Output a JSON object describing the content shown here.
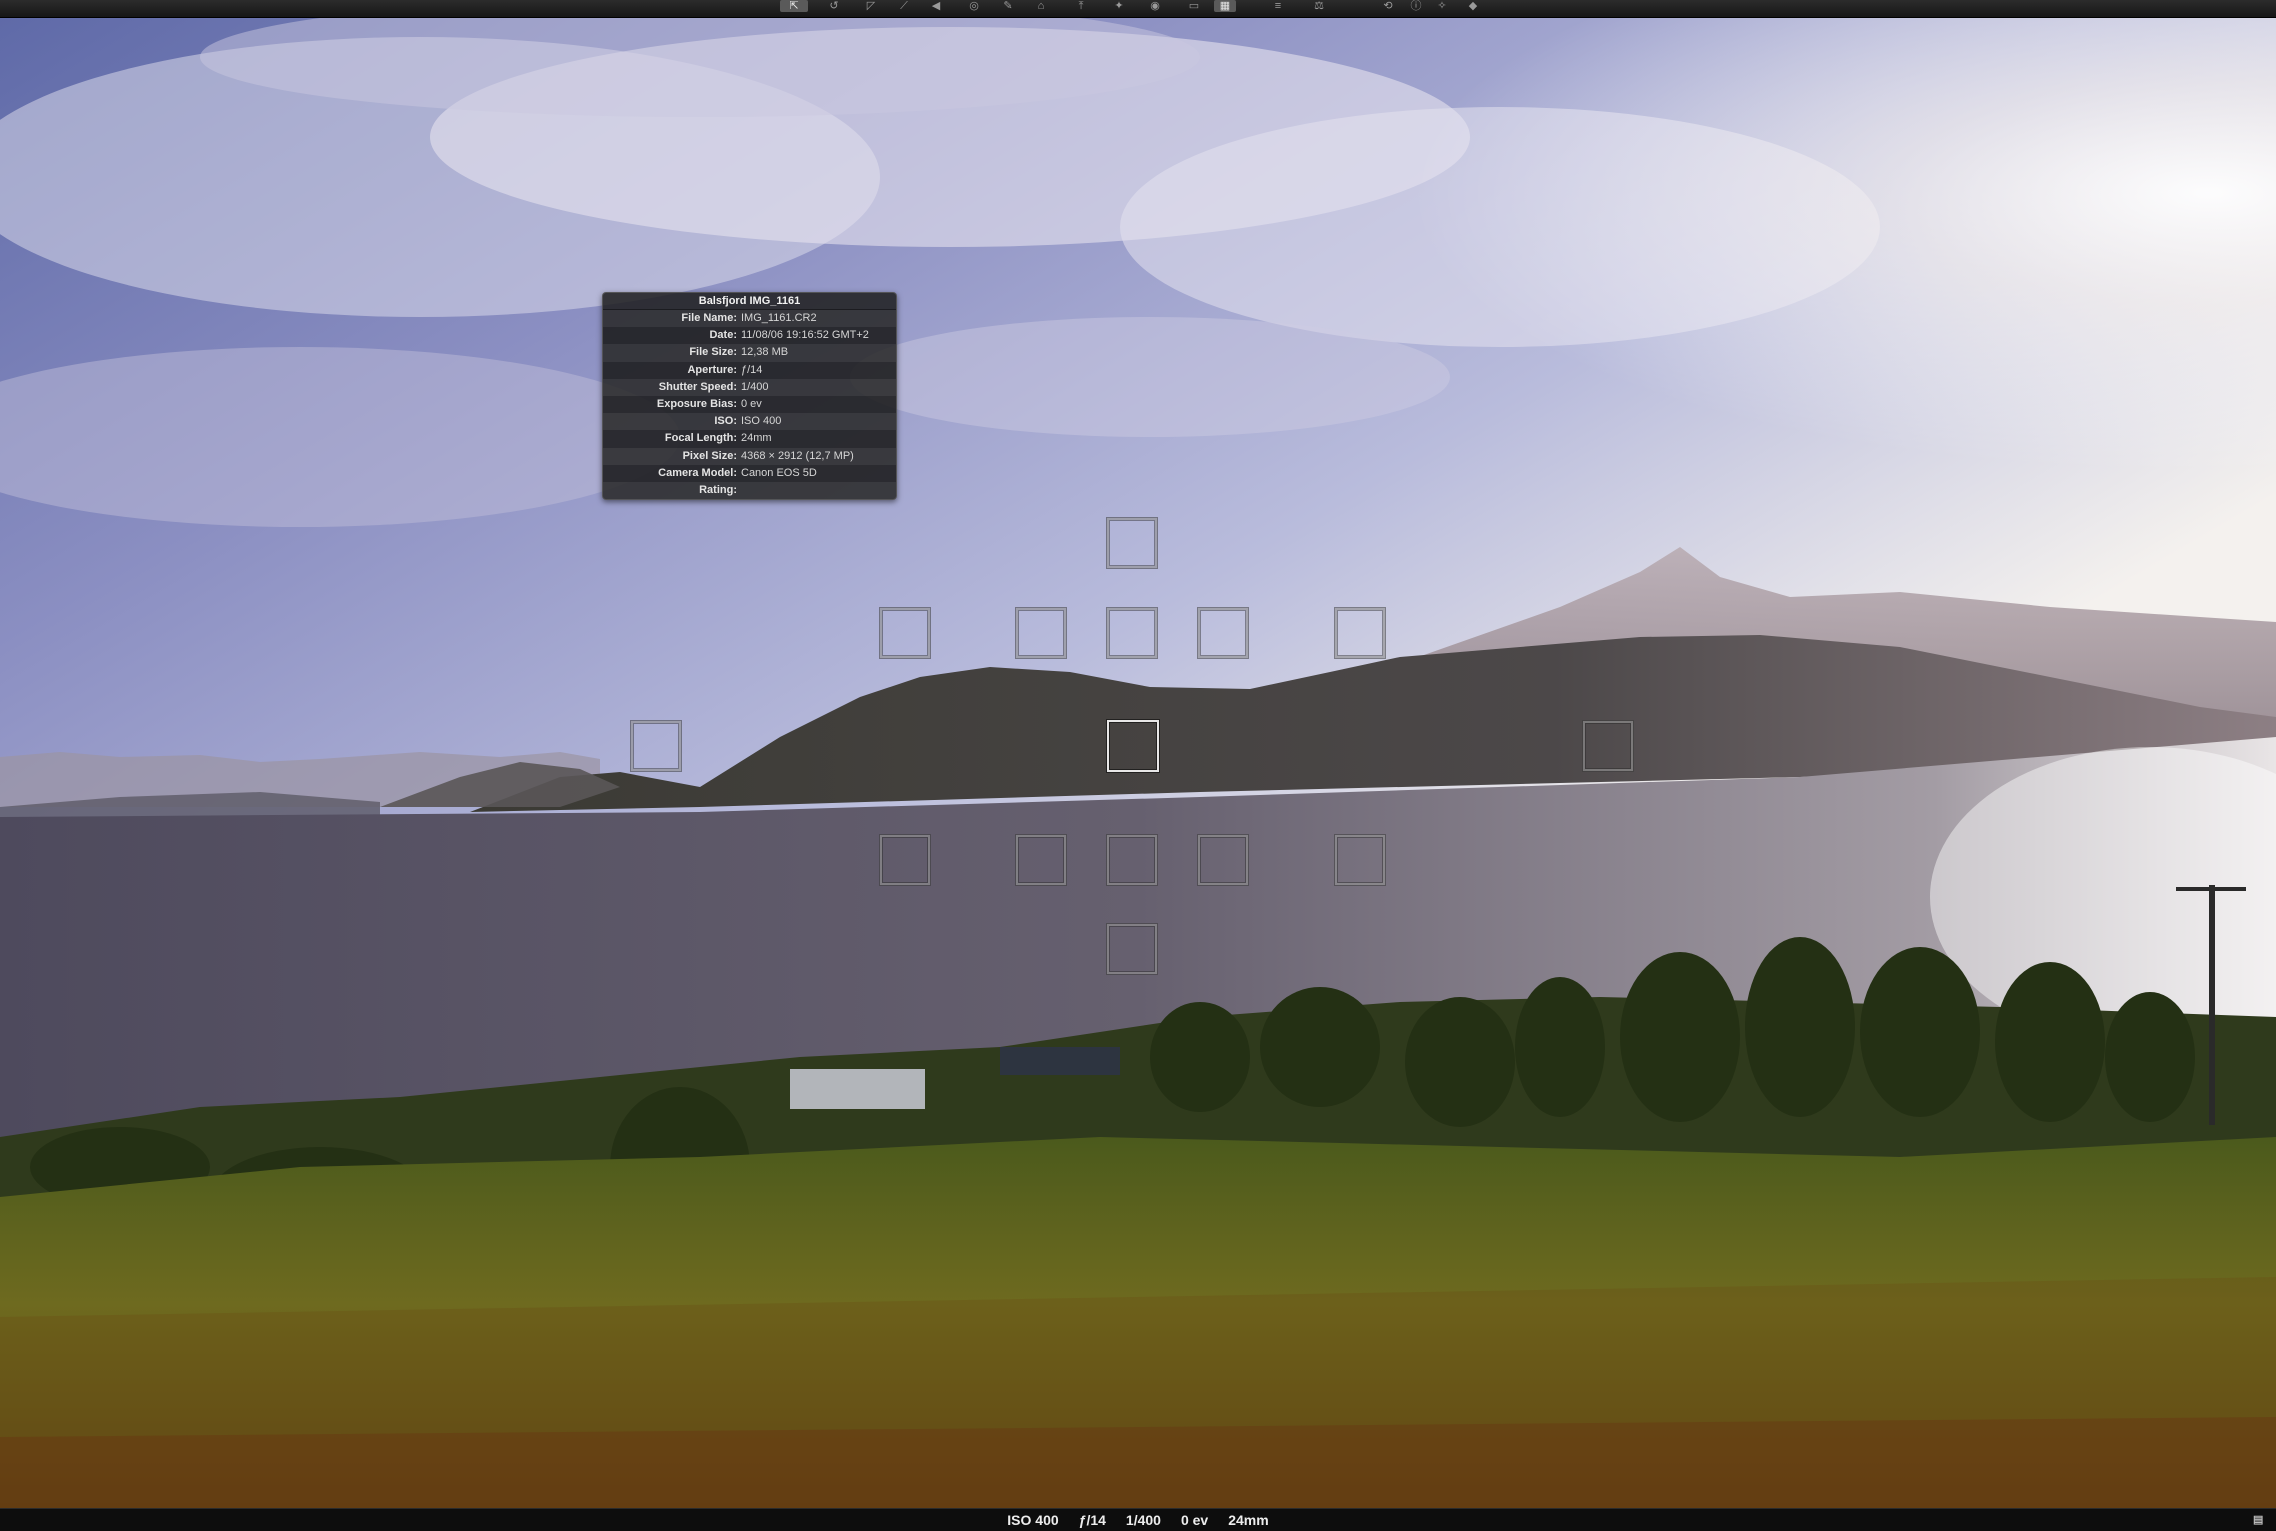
{
  "toolbar": {
    "tools": [
      {
        "name": "select-tool-icon",
        "glyph": "⇱",
        "active": true
      },
      {
        "name": "lasso-tool-icon",
        "glyph": "↺",
        "active": false
      },
      {
        "name": "crop-tool-icon",
        "glyph": "◸",
        "active": false
      },
      {
        "name": "straighten-tool-icon",
        "glyph": "⟋",
        "active": false
      },
      {
        "name": "flag-tool-icon",
        "glyph": "◀",
        "active": false
      },
      {
        "name": "loupe-tool-icon",
        "glyph": "◎",
        "active": false
      },
      {
        "name": "retouch-tool-icon",
        "glyph": "✎",
        "active": false
      },
      {
        "name": "stamp-tool-icon",
        "glyph": "⌂",
        "active": false
      },
      {
        "name": "lift-tool-icon",
        "glyph": "⤒",
        "active": false
      },
      {
        "name": "brush-tool-icon",
        "glyph": "✦",
        "active": false
      },
      {
        "name": "red-eye-tool-icon",
        "glyph": "◉",
        "active": false
      },
      {
        "name": "page-tool-icon",
        "glyph": "▭",
        "active": false
      },
      {
        "name": "grid-view-icon",
        "glyph": "▦",
        "active": true
      },
      {
        "name": "list-view-icon",
        "glyph": "≡",
        "active": false
      },
      {
        "name": "compare-icon",
        "glyph": "⚖",
        "active": false
      },
      {
        "name": "rotate-icon",
        "glyph": "⟲",
        "active": false
      },
      {
        "name": "info-icon",
        "glyph": "ⓘ",
        "active": false
      },
      {
        "name": "magic-icon",
        "glyph": "✧",
        "active": false
      },
      {
        "name": "adjust-icon",
        "glyph": "◆",
        "active": false
      }
    ]
  },
  "info_hud": {
    "title": "Balsfjord IMG_1161",
    "rows": [
      {
        "label": "File Name:",
        "value": "IMG_1161.CR2"
      },
      {
        "label": "Date:",
        "value": "11/08/06 19:16:52 GMT+2"
      },
      {
        "label": "File Size:",
        "value": "12,38 MB"
      },
      {
        "label": "Aperture:",
        "value": "ƒ/14"
      },
      {
        "label": "Shutter Speed:",
        "value": "1/400"
      },
      {
        "label": "Exposure Bias:",
        "value": "0 ev"
      },
      {
        "label": "ISO:",
        "value": "ISO 400"
      },
      {
        "label": "Focal Length:",
        "value": "24mm"
      },
      {
        "label": "Pixel Size:",
        "value": "4368 × 2912 (12,7 MP)"
      },
      {
        "label": "Camera Model:",
        "value": "Canon EOS 5D"
      },
      {
        "label": "Rating:",
        "value": ""
      }
    ]
  },
  "focus_points": {
    "selected": "center"
  },
  "status_bar": {
    "iso": "ISO 400",
    "aperture": "ƒ/14",
    "shutter": "1/400",
    "exposure": "0 ev",
    "focal_length": "24mm",
    "toggle_icon": "panel-toggle-icon"
  }
}
